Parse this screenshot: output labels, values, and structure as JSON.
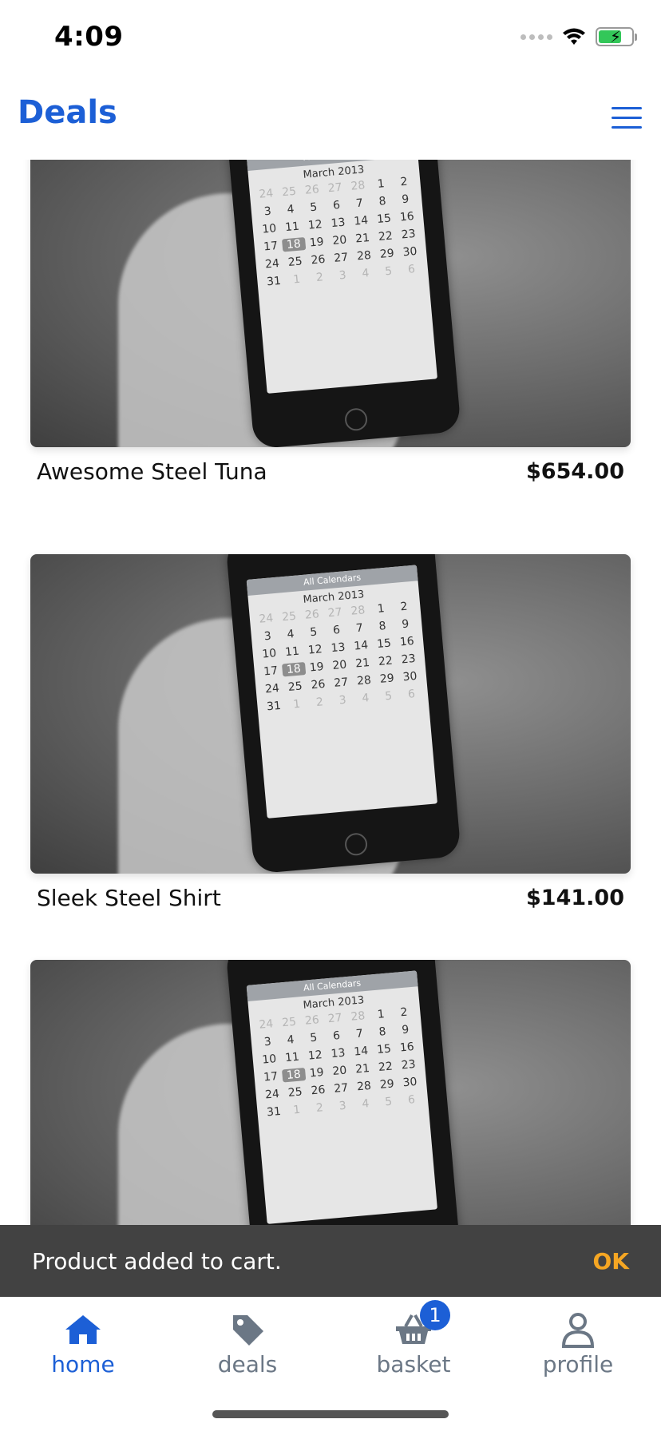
{
  "status_bar": {
    "time": "4:09"
  },
  "header": {
    "title": "Deals"
  },
  "deals": [
    {
      "name": "Awesome Steel Tuna",
      "price": "$654.00"
    },
    {
      "name": "Sleek Steel Shirt",
      "price": "$141.00"
    },
    {
      "name": "",
      "price": ""
    }
  ],
  "image": {
    "calendar_header": "All Calendars",
    "calendar_month": "March 2013"
  },
  "snackbar": {
    "message": "Product added to cart.",
    "action": "OK"
  },
  "bottom_nav": {
    "items": [
      {
        "label": "home",
        "icon": "home-icon",
        "active": true
      },
      {
        "label": "deals",
        "icon": "tag-icon",
        "active": false
      },
      {
        "label": "basket",
        "icon": "basket-icon",
        "active": false,
        "badge": "1"
      },
      {
        "label": "profile",
        "icon": "user-icon",
        "active": false
      }
    ]
  },
  "colors": {
    "accent": "#1c5fd6",
    "snackbar_bg": "#424242",
    "snackbar_action": "#f5a623",
    "inactive_nav": "#6b7785"
  }
}
